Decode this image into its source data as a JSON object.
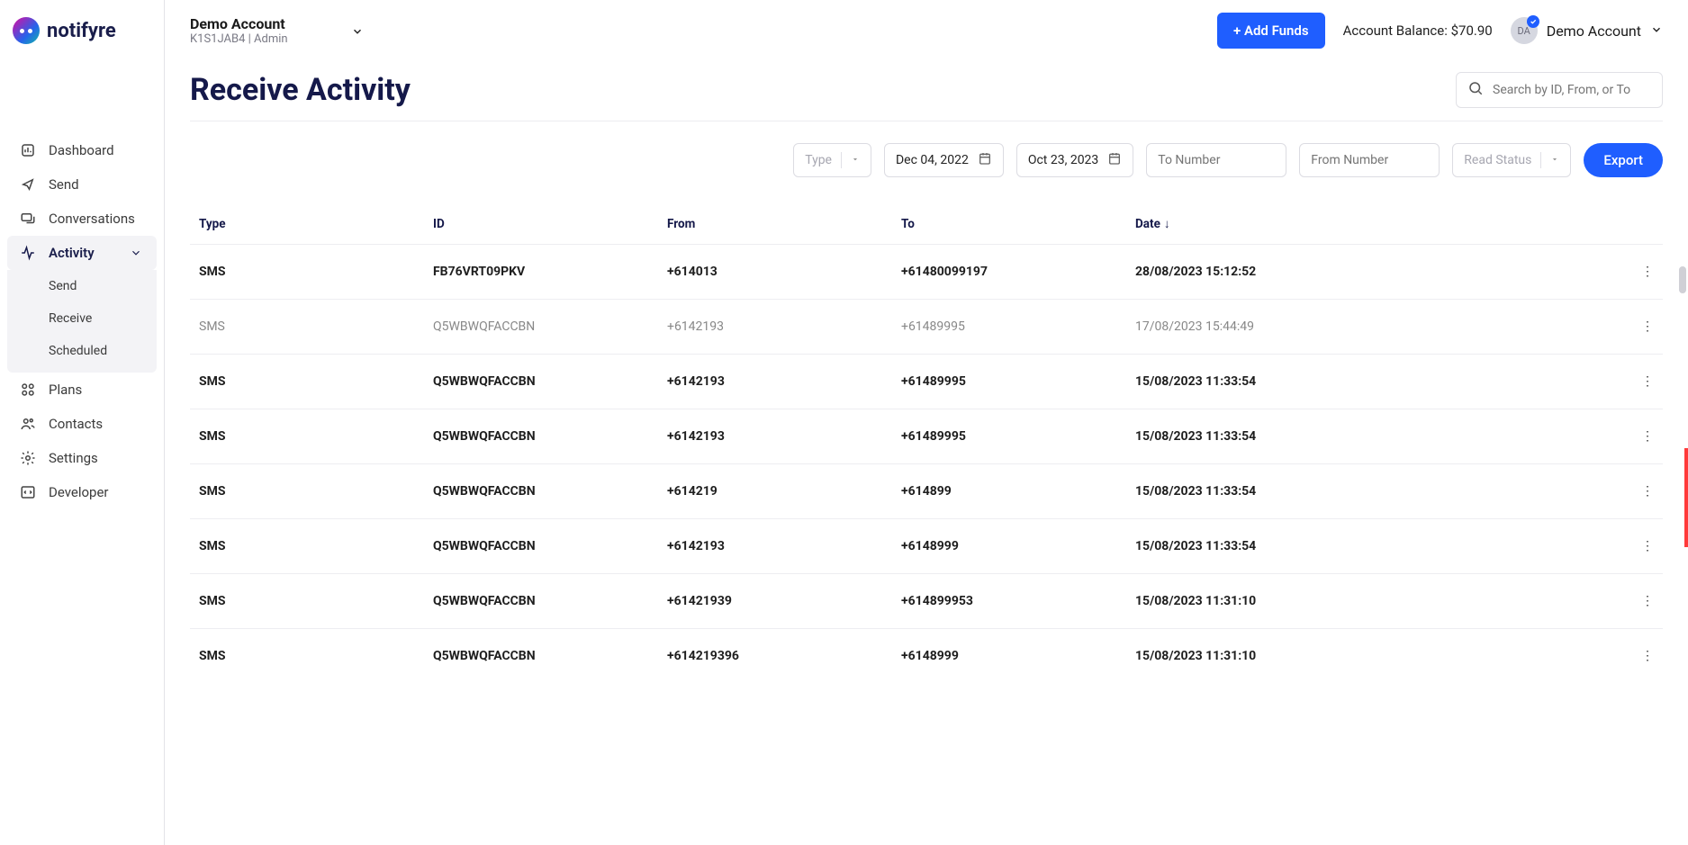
{
  "brand": "notifyre",
  "account_switcher": {
    "name": "Demo Account",
    "sub": "K1S1JAB4 | Admin"
  },
  "topbar": {
    "add_funds": "+ Add Funds",
    "balance_label": "Account Balance:",
    "balance_value": "$70.90",
    "profile_name": "Demo Account",
    "avatar_initials": "DA"
  },
  "page_title": "Receive Activity",
  "search_placeholder": "Search by ID, From, or To",
  "filters": {
    "type_label": "Type",
    "date_from": "Dec 04, 2022",
    "date_to": "Oct 23, 2023",
    "to_number_ph": "To Number",
    "from_number_ph": "From Number",
    "read_status_label": "Read Status",
    "export": "Export"
  },
  "nav": {
    "dashboard": "Dashboard",
    "send": "Send",
    "conversations": "Conversations",
    "activity": "Activity",
    "activity_sub": {
      "send": "Send",
      "receive": "Receive",
      "scheduled": "Scheduled"
    },
    "plans": "Plans",
    "contacts": "Contacts",
    "settings": "Settings",
    "developer": "Developer"
  },
  "columns": {
    "type": "Type",
    "id": "ID",
    "from": "From",
    "to": "To",
    "date": "Date"
  },
  "rows": [
    {
      "type": "SMS",
      "id": "FB76VRT09PKV",
      "from": "+614013",
      "to": "+61480099197",
      "date": "28/08/2023 15:12:52",
      "read": false
    },
    {
      "type": "SMS",
      "id": "Q5WBWQFACCBN",
      "from": "+6142193",
      "to": "+61489995",
      "date": "17/08/2023 15:44:49",
      "read": true
    },
    {
      "type": "SMS",
      "id": "Q5WBWQFACCBN",
      "from": "+6142193",
      "to": "+61489995",
      "date": "15/08/2023 11:33:54",
      "read": false
    },
    {
      "type": "SMS",
      "id": "Q5WBWQFACCBN",
      "from": "+6142193",
      "to": "+61489995",
      "date": "15/08/2023 11:33:54",
      "read": false
    },
    {
      "type": "SMS",
      "id": "Q5WBWQFACCBN",
      "from": "+614219",
      "to": "+614899",
      "date": "15/08/2023 11:33:54",
      "read": false
    },
    {
      "type": "SMS",
      "id": "Q5WBWQFACCBN",
      "from": "+6142193",
      "to": "+6148999",
      "date": "15/08/2023 11:33:54",
      "read": false
    },
    {
      "type": "SMS",
      "id": "Q5WBWQFACCBN",
      "from": "+61421939",
      "to": "+614899953",
      "date": "15/08/2023 11:31:10",
      "read": false
    },
    {
      "type": "SMS",
      "id": "Q5WBWQFACCBN",
      "from": "+614219396",
      "to": "+6148999",
      "date": "15/08/2023 11:31:10",
      "read": false
    }
  ]
}
